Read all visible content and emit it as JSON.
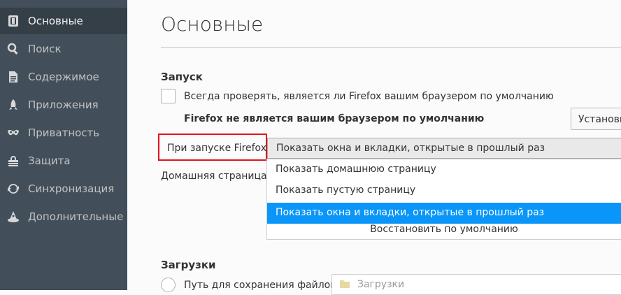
{
  "sidebar": {
    "items": [
      {
        "label": "Основные",
        "icon": "general-icon",
        "active": true
      },
      {
        "label": "Поиск",
        "icon": "search-icon"
      },
      {
        "label": "Содержимое",
        "icon": "document-icon"
      },
      {
        "label": "Приложения",
        "icon": "rocket-icon"
      },
      {
        "label": "Приватность",
        "icon": "mask-icon"
      },
      {
        "label": "Защита",
        "icon": "lock-icon"
      },
      {
        "label": "Синхронизация",
        "icon": "sync-icon"
      },
      {
        "label": "Дополнительные",
        "icon": "wizard-hat-icon"
      }
    ]
  },
  "main": {
    "title": "Основные",
    "startup": {
      "heading": "Запуск",
      "default_check_label": "Всегда проверять, является ли Firefox вашим браузером по умолчанию",
      "not_default_text": "Firefox не является вашим браузером по умолчанию",
      "set_default_button": "Установить",
      "on_startup_label": "При запуске Firefox:",
      "startup_select_value": "Показать окна и вкладки, открытые в прошлый раз",
      "startup_options": [
        "Показать домашнюю страницу",
        "Показать пустую страницу",
        "Показать окна и вкладки, открытые в прошлый раз"
      ],
      "homepage_label": "Домашняя страница:",
      "restore_default": "Восстановить по умолчанию"
    },
    "downloads": {
      "heading": "Загрузки",
      "save_path_label": "Путь для сохранения файлов",
      "save_path_value": "Загрузки"
    }
  }
}
